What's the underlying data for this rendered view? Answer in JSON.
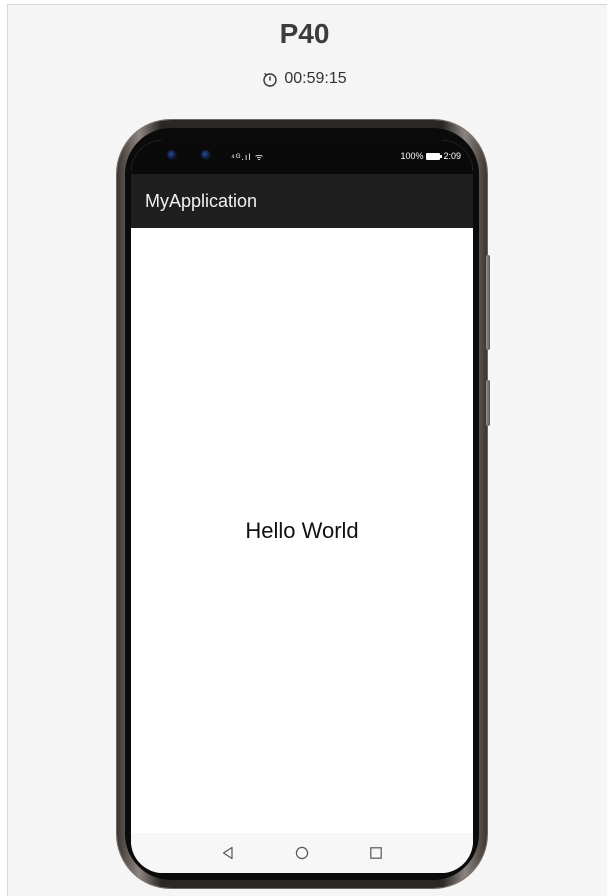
{
  "device": {
    "name": "P40",
    "timer": "00:59:15"
  },
  "status_bar": {
    "signal": "⁴ᴳ.ıl ᯤ",
    "battery_percent": "100%",
    "time": "2:09"
  },
  "app": {
    "title": "MyApplication",
    "content_text": "Hello World"
  },
  "nav": {
    "icons": [
      "back-icon",
      "home-icon",
      "recents-icon"
    ]
  },
  "colors": {
    "app_bar": "#1f1f1f",
    "status_bar": "#0a0a0a",
    "panel_bg": "#f5f5f5",
    "phone_frame": "#2b2724"
  }
}
